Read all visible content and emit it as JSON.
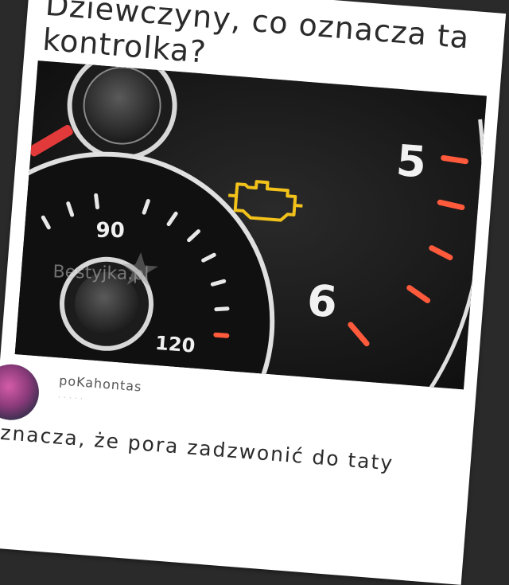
{
  "post": {
    "title": "Dziewczyny, co oznacza ta kontrolka?",
    "image": {
      "gauge_numbers": [
        "5",
        "6",
        "90",
        "120"
      ],
      "watermark": "Bestyjka.pl",
      "warning_icon": "check-engine-icon",
      "accent_color": "#ff5a3c",
      "warning_color": "#f2c21b"
    }
  },
  "comment": {
    "author": "poKahontas",
    "meta": "· · · · ·",
    "text": "Oznacza, że pora zadzwonić do taty"
  }
}
